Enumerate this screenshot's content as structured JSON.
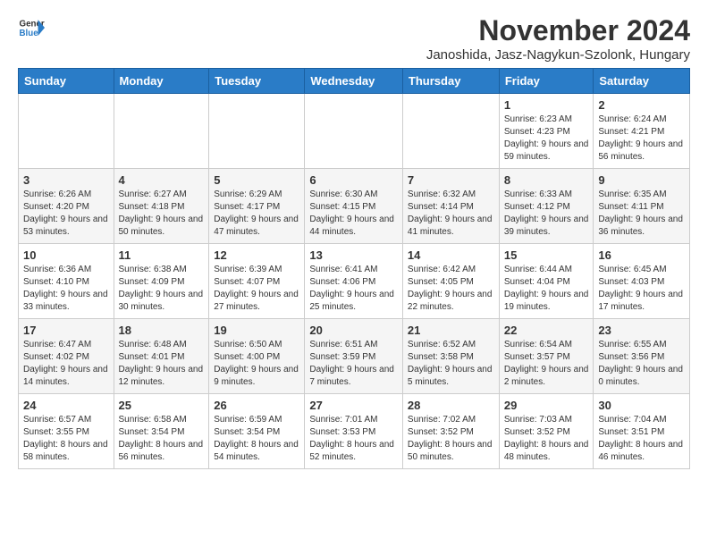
{
  "header": {
    "logo_text_general": "General",
    "logo_text_blue": "Blue",
    "title": "November 2024",
    "subtitle": "Janoshida, Jasz-Nagykun-Szolonk, Hungary"
  },
  "calendar": {
    "days_of_week": [
      "Sunday",
      "Monday",
      "Tuesday",
      "Wednesday",
      "Thursday",
      "Friday",
      "Saturday"
    ],
    "weeks": [
      [
        {
          "day": "",
          "detail": ""
        },
        {
          "day": "",
          "detail": ""
        },
        {
          "day": "",
          "detail": ""
        },
        {
          "day": "",
          "detail": ""
        },
        {
          "day": "",
          "detail": ""
        },
        {
          "day": "1",
          "detail": "Sunrise: 6:23 AM\nSunset: 4:23 PM\nDaylight: 9 hours and 59 minutes."
        },
        {
          "day": "2",
          "detail": "Sunrise: 6:24 AM\nSunset: 4:21 PM\nDaylight: 9 hours and 56 minutes."
        }
      ],
      [
        {
          "day": "3",
          "detail": "Sunrise: 6:26 AM\nSunset: 4:20 PM\nDaylight: 9 hours and 53 minutes."
        },
        {
          "day": "4",
          "detail": "Sunrise: 6:27 AM\nSunset: 4:18 PM\nDaylight: 9 hours and 50 minutes."
        },
        {
          "day": "5",
          "detail": "Sunrise: 6:29 AM\nSunset: 4:17 PM\nDaylight: 9 hours and 47 minutes."
        },
        {
          "day": "6",
          "detail": "Sunrise: 6:30 AM\nSunset: 4:15 PM\nDaylight: 9 hours and 44 minutes."
        },
        {
          "day": "7",
          "detail": "Sunrise: 6:32 AM\nSunset: 4:14 PM\nDaylight: 9 hours and 41 minutes."
        },
        {
          "day": "8",
          "detail": "Sunrise: 6:33 AM\nSunset: 4:12 PM\nDaylight: 9 hours and 39 minutes."
        },
        {
          "day": "9",
          "detail": "Sunrise: 6:35 AM\nSunset: 4:11 PM\nDaylight: 9 hours and 36 minutes."
        }
      ],
      [
        {
          "day": "10",
          "detail": "Sunrise: 6:36 AM\nSunset: 4:10 PM\nDaylight: 9 hours and 33 minutes."
        },
        {
          "day": "11",
          "detail": "Sunrise: 6:38 AM\nSunset: 4:09 PM\nDaylight: 9 hours and 30 minutes."
        },
        {
          "day": "12",
          "detail": "Sunrise: 6:39 AM\nSunset: 4:07 PM\nDaylight: 9 hours and 27 minutes."
        },
        {
          "day": "13",
          "detail": "Sunrise: 6:41 AM\nSunset: 4:06 PM\nDaylight: 9 hours and 25 minutes."
        },
        {
          "day": "14",
          "detail": "Sunrise: 6:42 AM\nSunset: 4:05 PM\nDaylight: 9 hours and 22 minutes."
        },
        {
          "day": "15",
          "detail": "Sunrise: 6:44 AM\nSunset: 4:04 PM\nDaylight: 9 hours and 19 minutes."
        },
        {
          "day": "16",
          "detail": "Sunrise: 6:45 AM\nSunset: 4:03 PM\nDaylight: 9 hours and 17 minutes."
        }
      ],
      [
        {
          "day": "17",
          "detail": "Sunrise: 6:47 AM\nSunset: 4:02 PM\nDaylight: 9 hours and 14 minutes."
        },
        {
          "day": "18",
          "detail": "Sunrise: 6:48 AM\nSunset: 4:01 PM\nDaylight: 9 hours and 12 minutes."
        },
        {
          "day": "19",
          "detail": "Sunrise: 6:50 AM\nSunset: 4:00 PM\nDaylight: 9 hours and 9 minutes."
        },
        {
          "day": "20",
          "detail": "Sunrise: 6:51 AM\nSunset: 3:59 PM\nDaylight: 9 hours and 7 minutes."
        },
        {
          "day": "21",
          "detail": "Sunrise: 6:52 AM\nSunset: 3:58 PM\nDaylight: 9 hours and 5 minutes."
        },
        {
          "day": "22",
          "detail": "Sunrise: 6:54 AM\nSunset: 3:57 PM\nDaylight: 9 hours and 2 minutes."
        },
        {
          "day": "23",
          "detail": "Sunrise: 6:55 AM\nSunset: 3:56 PM\nDaylight: 9 hours and 0 minutes."
        }
      ],
      [
        {
          "day": "24",
          "detail": "Sunrise: 6:57 AM\nSunset: 3:55 PM\nDaylight: 8 hours and 58 minutes."
        },
        {
          "day": "25",
          "detail": "Sunrise: 6:58 AM\nSunset: 3:54 PM\nDaylight: 8 hours and 56 minutes."
        },
        {
          "day": "26",
          "detail": "Sunrise: 6:59 AM\nSunset: 3:54 PM\nDaylight: 8 hours and 54 minutes."
        },
        {
          "day": "27",
          "detail": "Sunrise: 7:01 AM\nSunset: 3:53 PM\nDaylight: 8 hours and 52 minutes."
        },
        {
          "day": "28",
          "detail": "Sunrise: 7:02 AM\nSunset: 3:52 PM\nDaylight: 8 hours and 50 minutes."
        },
        {
          "day": "29",
          "detail": "Sunrise: 7:03 AM\nSunset: 3:52 PM\nDaylight: 8 hours and 48 minutes."
        },
        {
          "day": "30",
          "detail": "Sunrise: 7:04 AM\nSunset: 3:51 PM\nDaylight: 8 hours and 46 minutes."
        }
      ]
    ]
  }
}
